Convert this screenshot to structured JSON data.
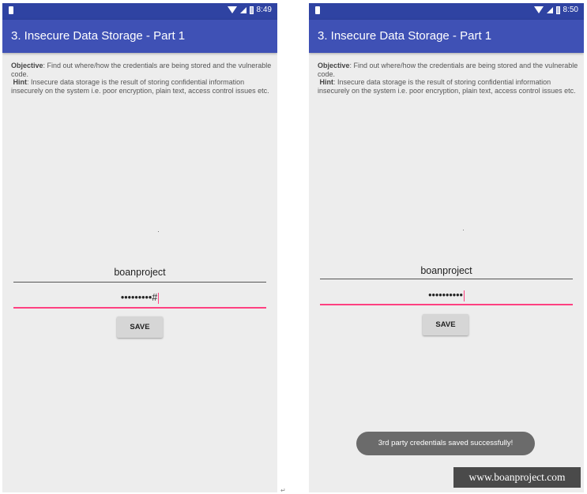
{
  "left_screen": {
    "status_time": "8:49",
    "app_title": "3. Insecure Data Storage - Part 1",
    "objective_label": "Objective",
    "objective_text": ": Find out where/how the credentials are being stored and the vulnerable code.",
    "hint_label": "Hint",
    "hint_text": ": Insecure data storage is the result of storing confidential information insecurely on the system i.e. poor encryption, plain text, access control issues etc.",
    "username_value": "boanproject",
    "password_value": "•••••••••#",
    "save_label": "SAVE"
  },
  "right_screen": {
    "status_time": "8:50",
    "app_title": "3. Insecure Data Storage - Part 1",
    "objective_label": "Objective",
    "objective_text": ": Find out where/how the credentials are being stored and the vulnerable code.",
    "hint_label": "Hint",
    "hint_text": ": Insecure data storage is the result of storing confidential information insecurely on the system i.e. poor encryption, plain text, access control issues etc.",
    "username_value": "boanproject",
    "password_value": "••••••••••",
    "save_label": "SAVE",
    "toast_text": "3rd party credentials saved successfully!"
  },
  "watermark": "www.boanproject.com",
  "return_glyph": "↵",
  "colors": {
    "status_bar": "#2f43a2",
    "app_bar": "#3f51b5",
    "accent": "#ff4081",
    "background": "#ededed"
  },
  "icons": [
    "sim-icon",
    "wifi-icon",
    "signal-icon",
    "battery-icon"
  ]
}
